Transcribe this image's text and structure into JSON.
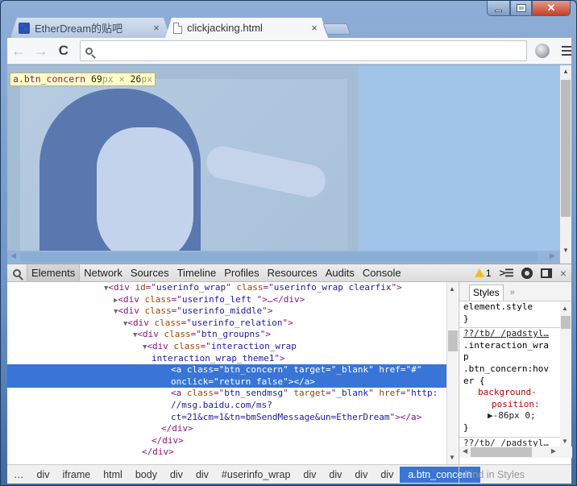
{
  "window": {
    "controls": {
      "minimize": "minimize",
      "maximize": "maximize",
      "close": "✕"
    }
  },
  "tabs": [
    {
      "label": "EtherDream的贴吧",
      "icon": "paw-favicon-icon",
      "active": false
    },
    {
      "label": "clickjacking.html",
      "icon": "page-favicon-icon",
      "active": true
    }
  ],
  "tab_close_glyph": "×",
  "toolbar": {
    "back_glyph": "←",
    "forward_glyph": "→",
    "reload_glyph": "C",
    "omnibox_value": "",
    "omnibox_placeholder": ""
  },
  "viewport": {
    "tooltip": {
      "selector": "a.btn_concern",
      "width": "69",
      "height": "26",
      "unit": "px",
      "times": "×"
    },
    "colors": {
      "highlight_overlay": "#a1c4e9",
      "tooltip_bg": "#ffffc2"
    }
  },
  "devtools": {
    "tabs": [
      "Elements",
      "Network",
      "Sources",
      "Timeline",
      "Profiles",
      "Resources",
      "Audits",
      "Console"
    ],
    "active_tab": "Elements",
    "warning_count": "1",
    "close_glyph": "×",
    "elements": [
      {
        "indent": 10,
        "tri": "▼",
        "parts": [
          [
            "tag",
            "<div "
          ],
          [
            "an",
            "id"
          ],
          [
            "tag",
            "=\""
          ],
          [
            "av",
            "userinfo_wrap"
          ],
          [
            "tag",
            "\" "
          ],
          [
            "an",
            "class"
          ],
          [
            "tag",
            "=\""
          ],
          [
            "av",
            "userinfo_wrap clearfix"
          ],
          [
            "tag",
            "\">"
          ]
        ]
      },
      {
        "indent": 11,
        "tri": "▶",
        "parts": [
          [
            "tag",
            "<div "
          ],
          [
            "an",
            "class"
          ],
          [
            "tag",
            "=\""
          ],
          [
            "av",
            "userinfo_left "
          ],
          [
            "tag",
            "\">…</div>"
          ]
        ]
      },
      {
        "indent": 11,
        "tri": "▼",
        "parts": [
          [
            "tag",
            "<div "
          ],
          [
            "an",
            "class"
          ],
          [
            "tag",
            "=\""
          ],
          [
            "av",
            "userinfo_middle"
          ],
          [
            "tag",
            "\">"
          ]
        ]
      },
      {
        "indent": 12,
        "tri": "▼",
        "parts": [
          [
            "tag",
            "<div "
          ],
          [
            "an",
            "class"
          ],
          [
            "tag",
            "=\""
          ],
          [
            "av",
            "userinfo_relation"
          ],
          [
            "tag",
            "\">"
          ]
        ]
      },
      {
        "indent": 13,
        "tri": "▼",
        "parts": [
          [
            "tag",
            "<div "
          ],
          [
            "an",
            "class"
          ],
          [
            "tag",
            "=\""
          ],
          [
            "av",
            "btn_groupns"
          ],
          [
            "tag",
            "\">"
          ]
        ]
      },
      {
        "indent": 14,
        "tri": "▼",
        "parts": [
          [
            "tag",
            "<div "
          ],
          [
            "an",
            "class"
          ],
          [
            "tag",
            "=\""
          ],
          [
            "av",
            "interaction_wrap"
          ]
        ]
      },
      {
        "indent": 14,
        "tri": "",
        "parts": [
          [
            "av",
            "interaction_wrap_theme1"
          ],
          [
            "tag",
            "\">"
          ]
        ]
      },
      {
        "indent": 16,
        "tri": "",
        "selected": true,
        "parts": [
          [
            "tag",
            "<a "
          ],
          [
            "an",
            "class"
          ],
          [
            "tag",
            "=\""
          ],
          [
            "av",
            "btn_concern"
          ],
          [
            "tag",
            "\" "
          ],
          [
            "an",
            "target"
          ],
          [
            "tag",
            "=\""
          ],
          [
            "av",
            "_blank"
          ],
          [
            "tag",
            "\" "
          ],
          [
            "an",
            "href"
          ],
          [
            "tag",
            "=\""
          ],
          [
            "av",
            "#"
          ],
          [
            "tag",
            "\""
          ]
        ]
      },
      {
        "indent": 16,
        "tri": "",
        "selected": true,
        "parts": [
          [
            "an",
            "onclick"
          ],
          [
            "tag",
            "=\""
          ],
          [
            "av",
            "return false"
          ],
          [
            "tag",
            "\"></a>"
          ]
        ]
      },
      {
        "indent": 16,
        "tri": "",
        "parts": [
          [
            "tag",
            "<a "
          ],
          [
            "an",
            "class"
          ],
          [
            "tag",
            "=\""
          ],
          [
            "av",
            "btn_sendmsg"
          ],
          [
            "tag",
            "\" "
          ],
          [
            "an",
            "target"
          ],
          [
            "tag",
            "=\""
          ],
          [
            "av",
            "_blank"
          ],
          [
            "tag",
            "\" "
          ],
          [
            "an",
            "href"
          ],
          [
            "tag",
            "=\""
          ],
          [
            "av",
            "http:"
          ]
        ]
      },
      {
        "indent": 16,
        "tri": "",
        "parts": [
          [
            "av",
            "//msg.baidu.com/ms?"
          ]
        ]
      },
      {
        "indent": 16,
        "tri": "",
        "parts": [
          [
            "av",
            "ct=21&cm=1&tn=bmSendMessage&un=EtherDream"
          ],
          [
            "tag",
            "\"></a>"
          ]
        ]
      },
      {
        "indent": 15,
        "tri": "",
        "parts": [
          [
            "tag",
            "</div>"
          ]
        ]
      },
      {
        "indent": 14,
        "tri": "",
        "parts": [
          [
            "tag",
            "</div>"
          ]
        ]
      },
      {
        "indent": 13,
        "tri": "",
        "parts": [
          [
            "tag",
            "</div>"
          ]
        ]
      }
    ],
    "styles": {
      "tab": "Styles",
      "more": "»",
      "element_style": "element.style",
      "element_style_close": "}",
      "source_link": "??/tb/ /padstyl…",
      "selector_lines": [
        ".interaction_wra",
        "p",
        ".btn_concern:hov",
        "er {"
      ],
      "prop_name_1": "background-",
      "prop_name_2": "position:",
      "prop_value": "▶-86px 0;",
      "rule_close": "}",
      "source_link_2": "??/tb/ /padstyl…"
    },
    "breadcrumbs": [
      "…",
      "div",
      "iframe",
      "html",
      "body",
      "div",
      "div",
      "#userinfo_wrap",
      "div",
      "div",
      "div",
      "div",
      "a.btn_concern"
    ],
    "selected_breadcrumb": "a.btn_concern",
    "find_placeholder": "Find in Styles",
    "colors": {
      "selection": "#3875d7",
      "tag": "#881280",
      "attr_name": "#994500",
      "attr_value": "#1a1aa6",
      "prop_name": "#c80000"
    }
  }
}
